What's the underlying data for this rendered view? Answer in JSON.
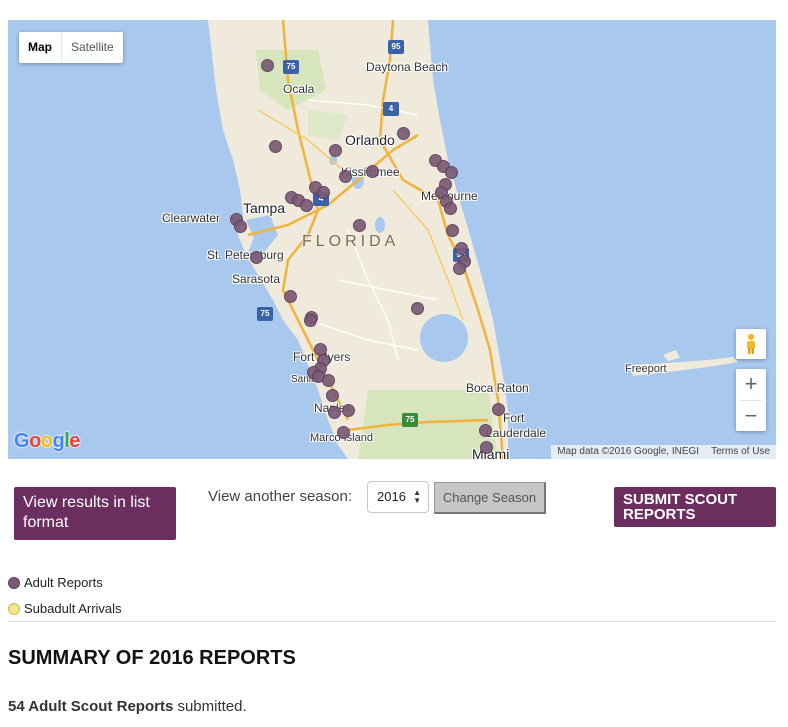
{
  "map": {
    "type_control": {
      "map_label": "Map",
      "satellite_label": "Satellite"
    },
    "state_label": "FLORIDA",
    "cities": [
      {
        "id": "ocala",
        "label": "Ocala"
      },
      {
        "id": "daytona",
        "label": "Daytona Beach"
      },
      {
        "id": "orlando",
        "label": "Orlando"
      },
      {
        "id": "kissimmee",
        "label": "Kissimmee"
      },
      {
        "id": "melbourne",
        "label": "Melbourne"
      },
      {
        "id": "clearwater",
        "label": "Clearwater"
      },
      {
        "id": "tampa",
        "label": "Tampa"
      },
      {
        "id": "stpete",
        "label": "St. Petersburg"
      },
      {
        "id": "sarasota",
        "label": "Sarasota"
      },
      {
        "id": "fortmyers",
        "label": "Fort Myers"
      },
      {
        "id": "sanibel",
        "label": "Sanibel"
      },
      {
        "id": "naples",
        "label": "Naples"
      },
      {
        "id": "marco",
        "label": "Marco Island"
      },
      {
        "id": "freeport",
        "label": "Freeport"
      },
      {
        "id": "bocaraton",
        "label": "Boca Raton"
      },
      {
        "id": "fortlaud1",
        "label": "Fort"
      },
      {
        "id": "fortlaud2",
        "label": "Lauderdale"
      },
      {
        "id": "miami",
        "label": "Miami"
      }
    ],
    "shields": [
      "95",
      "75",
      "4",
      "4",
      "95",
      "75",
      "75"
    ],
    "zoom_in": "+",
    "zoom_out": "−",
    "google_logo": "Google",
    "attribution": {
      "data": "Map data ©2016 Google, INEGI",
      "terms": "Terms of Use"
    },
    "marker_color": "#7a5a77"
  },
  "controls": {
    "list_button": "View results in list format",
    "season_label": "View another season:",
    "season_value": "2016",
    "change_button": "Change Season",
    "submit_button": "SUBMIT SCOUT REPORTS"
  },
  "legend": {
    "adult": {
      "label": "Adult Reports",
      "color": "#7a5a77"
    },
    "subadult": {
      "label": "Subadult Arrivals",
      "color": "#f0e68c"
    }
  },
  "summary": {
    "title": "SUMMARY OF 2016 REPORTS",
    "count_bold": "54 Adult Scout Reports",
    "count_rest": " submitted."
  }
}
